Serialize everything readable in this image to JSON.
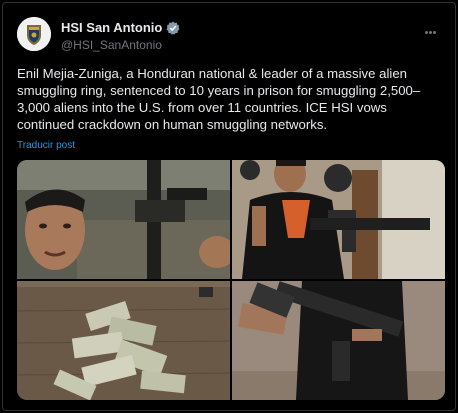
{
  "tweet": {
    "display_name": "HSI San Antonio",
    "handle": "@HSI_SanAntonio",
    "text": "Enil Mejia-Zuniga, a Honduran national & leader of a massive alien smuggling ring, sentenced to 10 years in prison for smuggling 2,500–3,000 aliens into the U.S. from over 11 countries. ICE HSI vows continued crackdown on human smuggling networks.",
    "translate_label": "Traducir post"
  },
  "icons": {
    "verified": "verified-badge-icon",
    "more": "more-options-icon"
  },
  "colors": {
    "background": "#000000",
    "text": "#e7e9ea",
    "secondary_text": "#71767b",
    "link": "#1d9bf0",
    "verified": "#829aab"
  },
  "media": {
    "count": 4,
    "items": [
      "photo-1",
      "photo-2",
      "photo-3",
      "photo-4"
    ]
  }
}
